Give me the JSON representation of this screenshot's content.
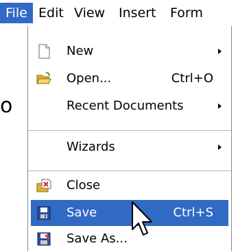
{
  "menubar": {
    "items": [
      {
        "label": "File"
      },
      {
        "label": "Edit"
      },
      {
        "label": "View"
      },
      {
        "label": "Insert"
      },
      {
        "label": "Form"
      }
    ]
  },
  "behind_text": "o",
  "file_menu": {
    "items": [
      {
        "label": "New",
        "icon": "new-document-icon",
        "submenu": true
      },
      {
        "label": "Open...",
        "shortcut": "Ctrl+O",
        "icon": "open-folder-icon"
      },
      {
        "label": "Recent Documents",
        "submenu": true
      },
      {
        "label": "Wizards",
        "submenu": true
      },
      {
        "label": "Close",
        "icon": "close-document-icon"
      },
      {
        "label": "Save",
        "shortcut": "Ctrl+S",
        "icon": "save-icon",
        "highlighted": true
      },
      {
        "label": "Save As...",
        "icon": "save-as-icon"
      }
    ]
  },
  "colors": {
    "highlight": "#316ac5",
    "highlight_text": "#ffffff"
  }
}
